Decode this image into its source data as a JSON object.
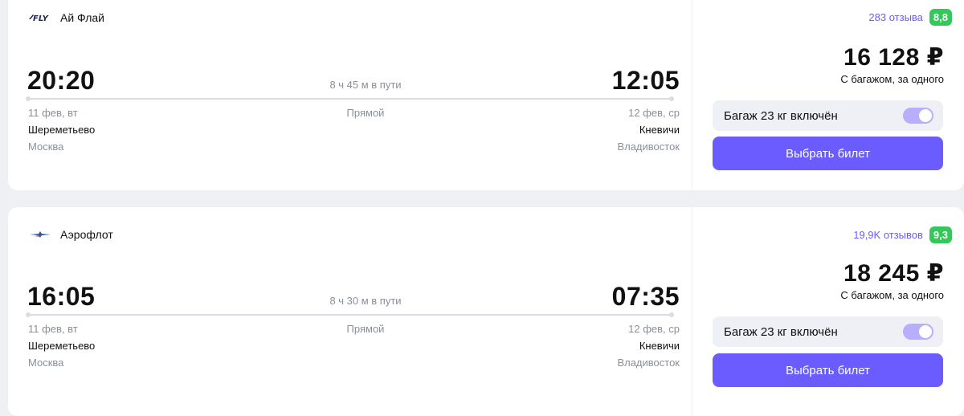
{
  "flights": [
    {
      "airline": {
        "name": "Ай Флай",
        "logo": "ifly-logo"
      },
      "departure": {
        "time": "20:20",
        "date": "11 фев, вт",
        "airport": "Шереметьево",
        "city": "Москва"
      },
      "arrival": {
        "time": "12:05",
        "date": "12 фев, ср",
        "airport": "Кневичи",
        "city": "Владивосток"
      },
      "duration": "8 ч 45 м в пути",
      "stops": "Прямой",
      "reviews": {
        "count": "283 отзыва",
        "score": "8,8"
      },
      "price": "16 128 ₽",
      "price_note": "С багажом, за одного",
      "baggage": {
        "label": "Багаж 23 кг включён",
        "enabled": true
      },
      "select_label": "Выбрать билет"
    },
    {
      "airline": {
        "name": "Аэрофлот",
        "logo": "aeroflot-logo"
      },
      "departure": {
        "time": "16:05",
        "date": "11 фев, вт",
        "airport": "Шереметьево",
        "city": "Москва"
      },
      "arrival": {
        "time": "07:35",
        "date": "12 фев, ср",
        "airport": "Кневичи",
        "city": "Владивосток"
      },
      "duration": "8 ч 30 м в пути",
      "stops": "Прямой",
      "reviews": {
        "count": "19,9K отзывов",
        "score": "9,3"
      },
      "price": "18 245 ₽",
      "price_note": "С багажом, за одного",
      "baggage": {
        "label": "Багаж 23 кг включён",
        "enabled": true
      },
      "select_label": "Выбрать билет"
    }
  ],
  "colors": {
    "accent": "#6b5cff",
    "rating": "#34c759",
    "toggle": "#b7aefc",
    "muted_text": "#8a8f99"
  }
}
